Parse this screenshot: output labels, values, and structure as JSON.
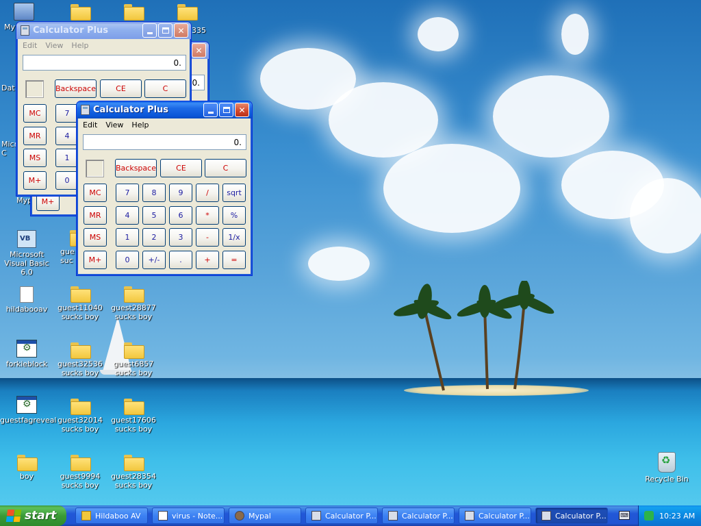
{
  "desktop": {
    "icons": [
      {
        "label": "My"
      },
      {
        "label": "Dat"
      },
      {
        "label": "Micro C"
      },
      {
        "label": "Myp"
      },
      {
        "label": "Microsoft Visual Basic 6.0"
      },
      {
        "label": "gue suc"
      },
      {
        "label": "hildabooav"
      },
      {
        "label": "guest11040 sucks boy"
      },
      {
        "label": "guest28877 sucks boy"
      },
      {
        "label": "forkieblock"
      },
      {
        "label": "guest32536 sucks boy"
      },
      {
        "label": "guest6857 sucks boy"
      },
      {
        "label": "guestfagreveal"
      },
      {
        "label": "guest32014 sucks boy"
      },
      {
        "label": "guest17606 sucks boy"
      },
      {
        "label": "boy"
      },
      {
        "label": "guest9994 sucks boy"
      },
      {
        "label": "guest28354 sucks boy"
      },
      {
        "label": "Recycle Bin"
      },
      {
        "label": "335"
      }
    ]
  },
  "calculator": {
    "title": "Calculator Plus",
    "menu": [
      "Edit",
      "View",
      "Help"
    ],
    "display_value": "0.",
    "back_display_value": "0.",
    "buttons": {
      "backspace": "Backspace",
      "ce": "CE",
      "c": "C",
      "mc": "MC",
      "mr": "MR",
      "ms": "MS",
      "mplus": "M+",
      "n7": "7",
      "n8": "8",
      "n9": "9",
      "div": "/",
      "sqrt": "sqrt",
      "n4": "4",
      "n5": "5",
      "n6": "6",
      "mul": "*",
      "pct": "%",
      "n1": "1",
      "n2": "2",
      "n3": "3",
      "sub": "-",
      "recip": "1/x",
      "n0": "0",
      "sign": "+/-",
      "dot": ".",
      "add": "+",
      "eq": "="
    }
  },
  "taskbar": {
    "start_label": "start",
    "tasks": [
      {
        "label": "Hildaboo AV"
      },
      {
        "label": "virus - Note..."
      },
      {
        "label": "Mypal"
      },
      {
        "label": "Calculator P..."
      },
      {
        "label": "Calculator P..."
      },
      {
        "label": "Calculator P..."
      },
      {
        "label": "Calculator P..."
      }
    ],
    "clock": "10:23 AM"
  },
  "colors": {
    "titlebar_active": "#0a56d8",
    "button_text_red": "#cc0000",
    "button_text_blue": "#1a1aa0",
    "start_green": "#3a9b36"
  }
}
